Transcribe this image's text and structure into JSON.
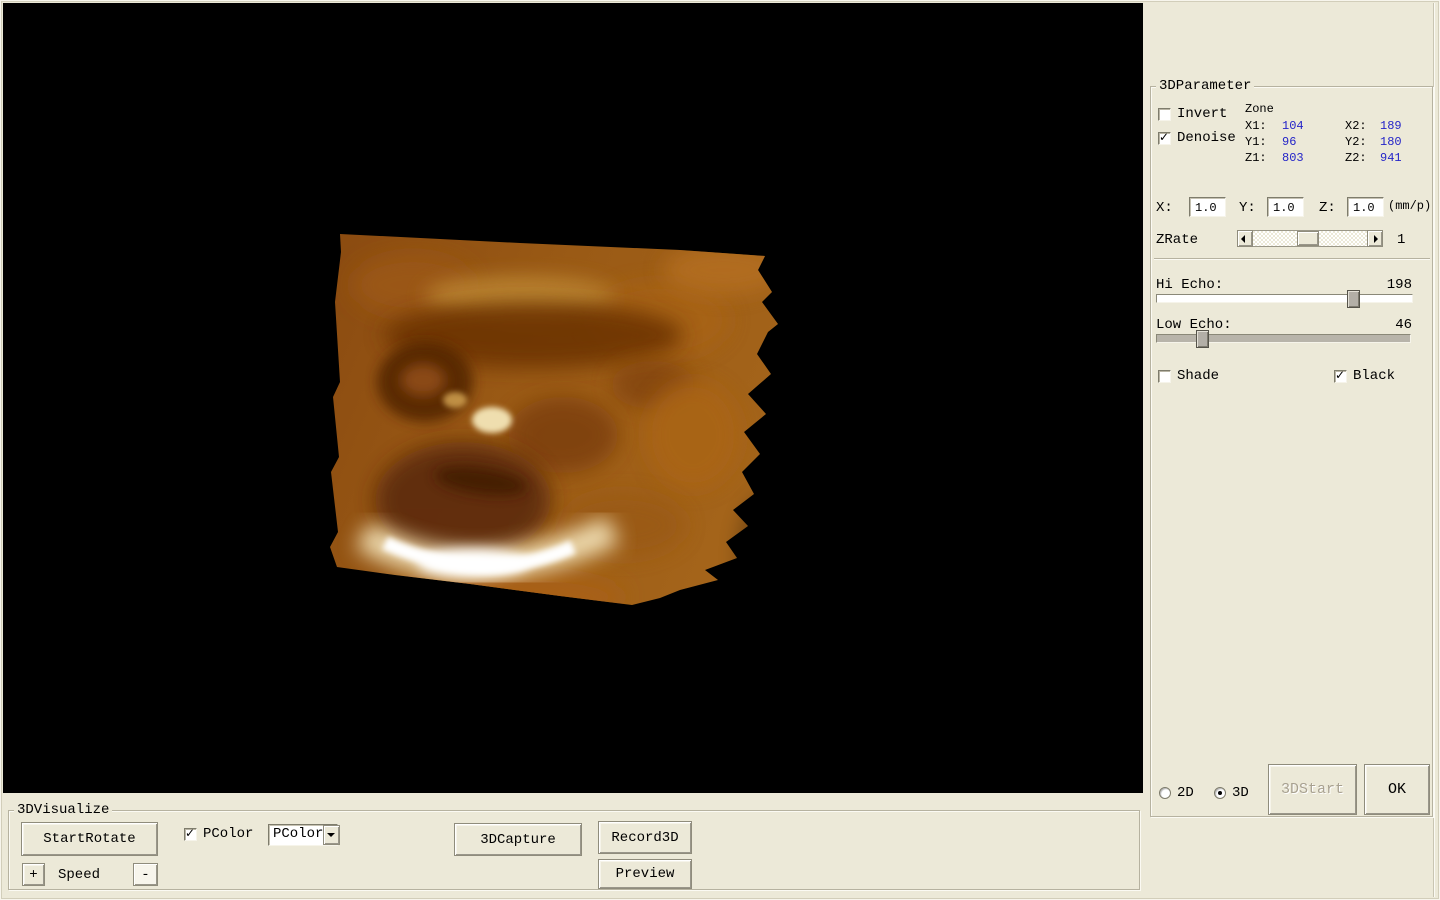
{
  "colors": {
    "background": "#ece9d8",
    "viewport": "#000000",
    "value_text": "#2424c8",
    "disabled_text": "#a8a190"
  },
  "param": {
    "title": "3DParameter",
    "invert": {
      "label": "Invert",
      "checked": false
    },
    "denoise": {
      "label": "Denoise",
      "checked": true
    },
    "zone": {
      "title": "Zone",
      "rows": [
        {
          "l_label": "X1:",
          "l_value": "104",
          "r_label": "X2:",
          "r_value": "189"
        },
        {
          "l_label": "Y1:",
          "l_value": "96",
          "r_label": "Y2:",
          "r_value": "180"
        },
        {
          "l_label": "Z1:",
          "l_value": "803",
          "r_label": "Z2:",
          "r_value": "941"
        }
      ]
    },
    "scale": {
      "x_label": "X:",
      "x_value": "1.0",
      "y_label": "Y:",
      "y_value": "1.0",
      "z_label": "Z:",
      "z_value": "1.0",
      "unit": "(mm/p)"
    },
    "zrate": {
      "label": "ZRate",
      "value": "1"
    },
    "hi_echo": {
      "label": "Hi Echo:",
      "value": "198"
    },
    "low_echo": {
      "label": "Low Echo:",
      "value": "46"
    },
    "shade": {
      "label": "Shade",
      "checked": false
    },
    "black": {
      "label": "Black",
      "checked": true
    },
    "mode_2d": {
      "label": "2D",
      "selected": false
    },
    "mode_3d": {
      "label": "3D",
      "selected": true
    },
    "start3d_button": "3DStart",
    "ok_button": "OK"
  },
  "visualize": {
    "title": "3DVisualize",
    "start_rotate_button": "StartRotate",
    "pcolor": {
      "label": "PColor",
      "checked": true
    },
    "pcolor_combo_value": "PColor",
    "capture_button": "3DCapture",
    "record_button": "Record3D",
    "preview_button": "Preview",
    "speed_plus": "+",
    "speed_label": "Speed",
    "speed_minus": "-"
  }
}
